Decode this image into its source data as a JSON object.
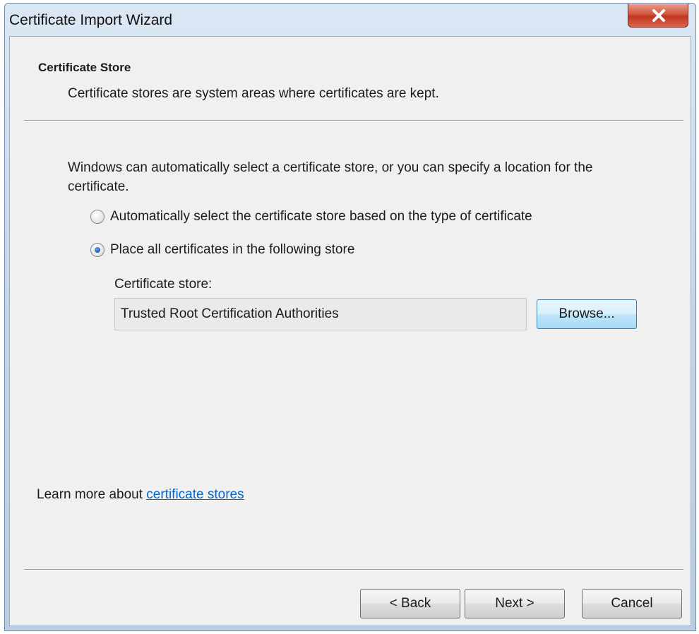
{
  "window": {
    "title": "Certificate Import Wizard",
    "close_icon": "close-icon"
  },
  "header": {
    "title": "Certificate Store",
    "subtitle": "Certificate stores are system areas where certificates are kept."
  },
  "body": {
    "intro": "Windows can automatically select a certificate store, or you can specify a location for the certificate.",
    "options": [
      {
        "label": "Automatically select the certificate store based on the type of certificate",
        "selected": false
      },
      {
        "label": "Place all certificates in the following store",
        "selected": true
      }
    ],
    "store_label": "Certificate store:",
    "store_value": "Trusted Root Certification Authorities",
    "browse_label": "Browse..."
  },
  "footer": {
    "learn_prefix": "Learn more about ",
    "learn_link": "certificate stores",
    "back_label": "< Back",
    "next_label": "Next >",
    "cancel_label": "Cancel"
  },
  "colors": {
    "link": "#0066cc",
    "close_button": "#c0371f",
    "dialog_background": "#f0f0f0"
  }
}
